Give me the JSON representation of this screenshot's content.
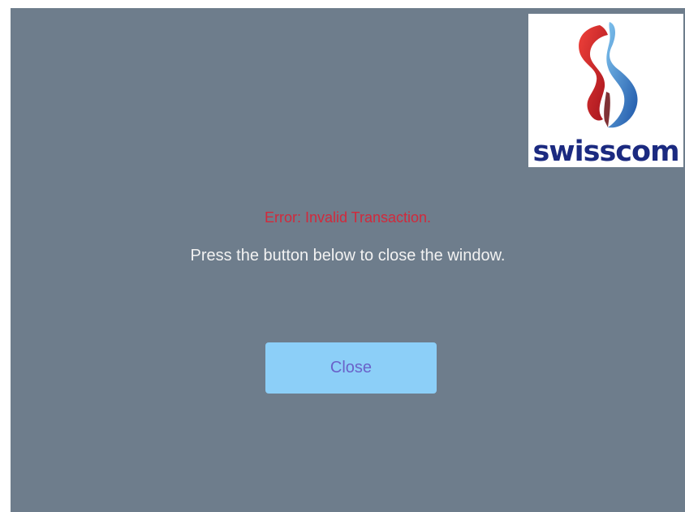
{
  "logo": {
    "text": "swisscom",
    "icon": "swisscom-logo-icon",
    "colors": {
      "red": "#d81f2a",
      "blue": "#2a74c4",
      "text": "#1b2a80"
    }
  },
  "message": {
    "error": "Error: Invalid Transaction.",
    "info": "Press the button below to close the window."
  },
  "actions": {
    "close_label": "Close"
  },
  "colors": {
    "background": "#6e7d8c",
    "error_text": "#d2293b",
    "button_bg": "#8ccff8",
    "button_text": "#6a62c9"
  }
}
